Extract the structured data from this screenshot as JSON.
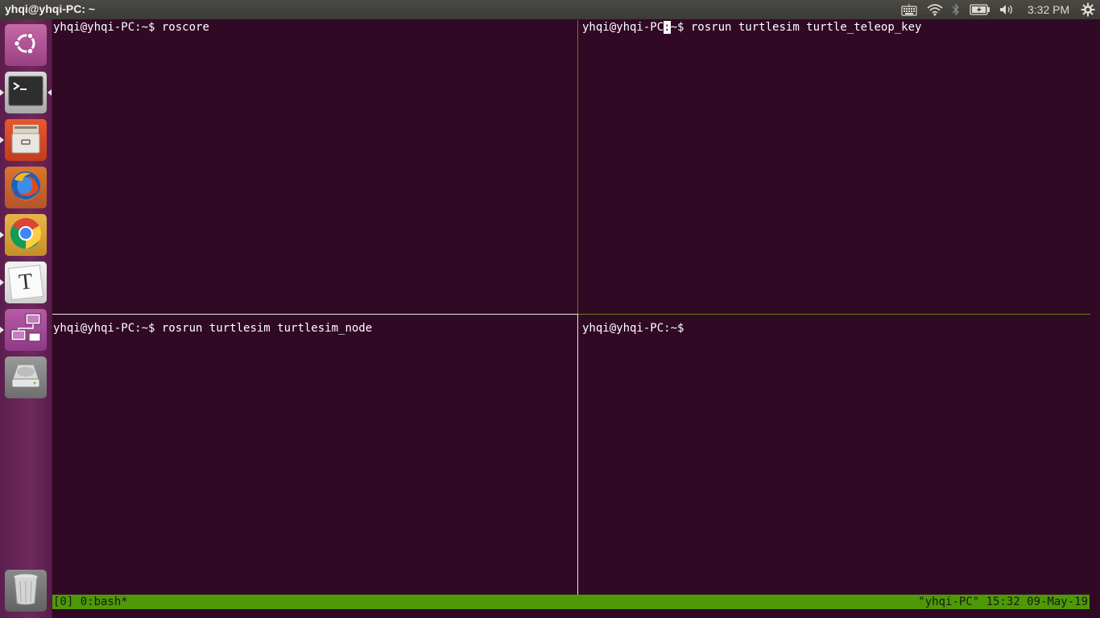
{
  "top_panel": {
    "title": "yhqi@yhqi-PC: ~",
    "clock": "3:32 PM",
    "indicators": [
      "keyboard-icon",
      "wifi-icon",
      "bluetooth-icon",
      "battery-icon",
      "volume-icon",
      "gear-icon"
    ]
  },
  "launcher": {
    "items": [
      {
        "name": "ubuntu-dash",
        "icon": "ubuntu-logo-icon"
      },
      {
        "name": "terminal",
        "icon": "terminal-icon"
      },
      {
        "name": "files",
        "icon": "file-cabinet-icon"
      },
      {
        "name": "firefox",
        "icon": "firefox-icon"
      },
      {
        "name": "chrome",
        "icon": "chrome-icon"
      },
      {
        "name": "text-editor",
        "icon": "text-editor-icon",
        "glyph": "T"
      },
      {
        "name": "remote-desktop",
        "icon": "network-computers-icon"
      },
      {
        "name": "disk",
        "icon": "hard-disk-icon"
      },
      {
        "name": "trash",
        "icon": "trash-icon"
      }
    ]
  },
  "terminal": {
    "panes": [
      {
        "prompt": "yhqi@yhqi-PC:~$",
        "command": " roscore"
      },
      {
        "prompt_before_cursor": "yhqi@yhqi-PC",
        "cursor_char": ":",
        "prompt_after_cursor": "~$",
        "command": " rosrun turtlesim turtle_teleop_key"
      },
      {
        "prompt": "yhqi@yhqi-PC:~$",
        "command": " rosrun turtlesim turtlesim_node"
      },
      {
        "prompt": "yhqi@yhqi-PC:~$",
        "command": ""
      }
    ]
  },
  "status_bar": {
    "left": "[0] 0:bash*",
    "right": "\"yhqi-PC\" 15:32 09-May-19"
  },
  "colors": {
    "terminal_bg": "#300a24",
    "status_bar": "#4e9a06",
    "active_border": "#7a8a2a"
  }
}
